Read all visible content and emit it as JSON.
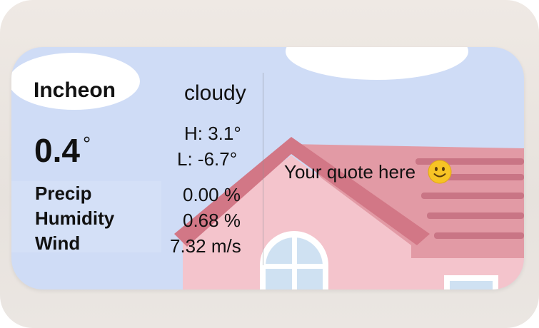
{
  "weather": {
    "city": "Incheon",
    "condition": "cloudy",
    "temperature": "0.4",
    "degree_symbol": "°",
    "high": "H: 3.1°",
    "low": "L: -6.7°",
    "stats": [
      {
        "label": "Precip",
        "value": "0.00 %"
      },
      {
        "label": "Humidity",
        "value": "0.68 %"
      },
      {
        "label": "Wind",
        "value": "7.32 m/s"
      }
    ]
  },
  "quote": {
    "text": "Your quote here",
    "emoji": "slightly-smiling-face-icon"
  },
  "colors": {
    "sky": "#cfdcf6",
    "cloud": "#ffffff",
    "house_wall": "#f4c4cc",
    "roof_dark": "#d27786",
    "roof_light": "#e29aa5",
    "window_glass": "#cfe1f2",
    "emoji_yellow": "#f7c325"
  }
}
